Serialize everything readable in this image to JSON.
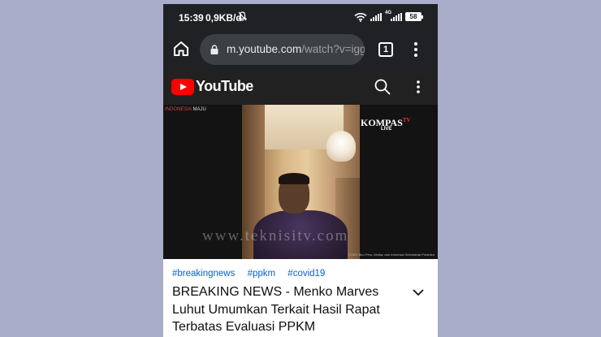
{
  "status_bar": {
    "time": "15:39",
    "net_speed": "0,9KB/d",
    "network_type": "4G",
    "battery": "58",
    "icons": [
      "mute-icon",
      "wifi-icon",
      "signal-icon",
      "signal-icon",
      "battery-icon"
    ]
  },
  "browser": {
    "url_domain": "m.youtube.com",
    "url_rest": "/watch?v=iggi",
    "tab_count": "1",
    "icons": [
      "home-icon",
      "lock-icon",
      "tabs-icon",
      "more-vert-icon"
    ]
  },
  "youtube": {
    "logo_text": "YouTube",
    "accent": "#ff0000",
    "icons": [
      "youtube-logo-icon",
      "search-icon",
      "more-vert-icon"
    ]
  },
  "video": {
    "overlay_left": "INDONESIA",
    "overlay_left_suffix": "MAJU",
    "channel_logo": "KOMPAS",
    "channel_logo_suffix": "TV",
    "live_label": "LIVE",
    "watermark": "www.teknisitv.com",
    "credit": "©2021 Biro Pers, Media, dan Informasi Sekretariat Presiden"
  },
  "video_info": {
    "hashtags": [
      "#breakingnews",
      "#ppkm",
      "#covid19"
    ],
    "title": "BREAKING NEWS - Menko Marves Luhut Umumkan Terkait Hasil Rapat Terbatas Evaluasi PPKM",
    "link_color": "#065fd4"
  }
}
